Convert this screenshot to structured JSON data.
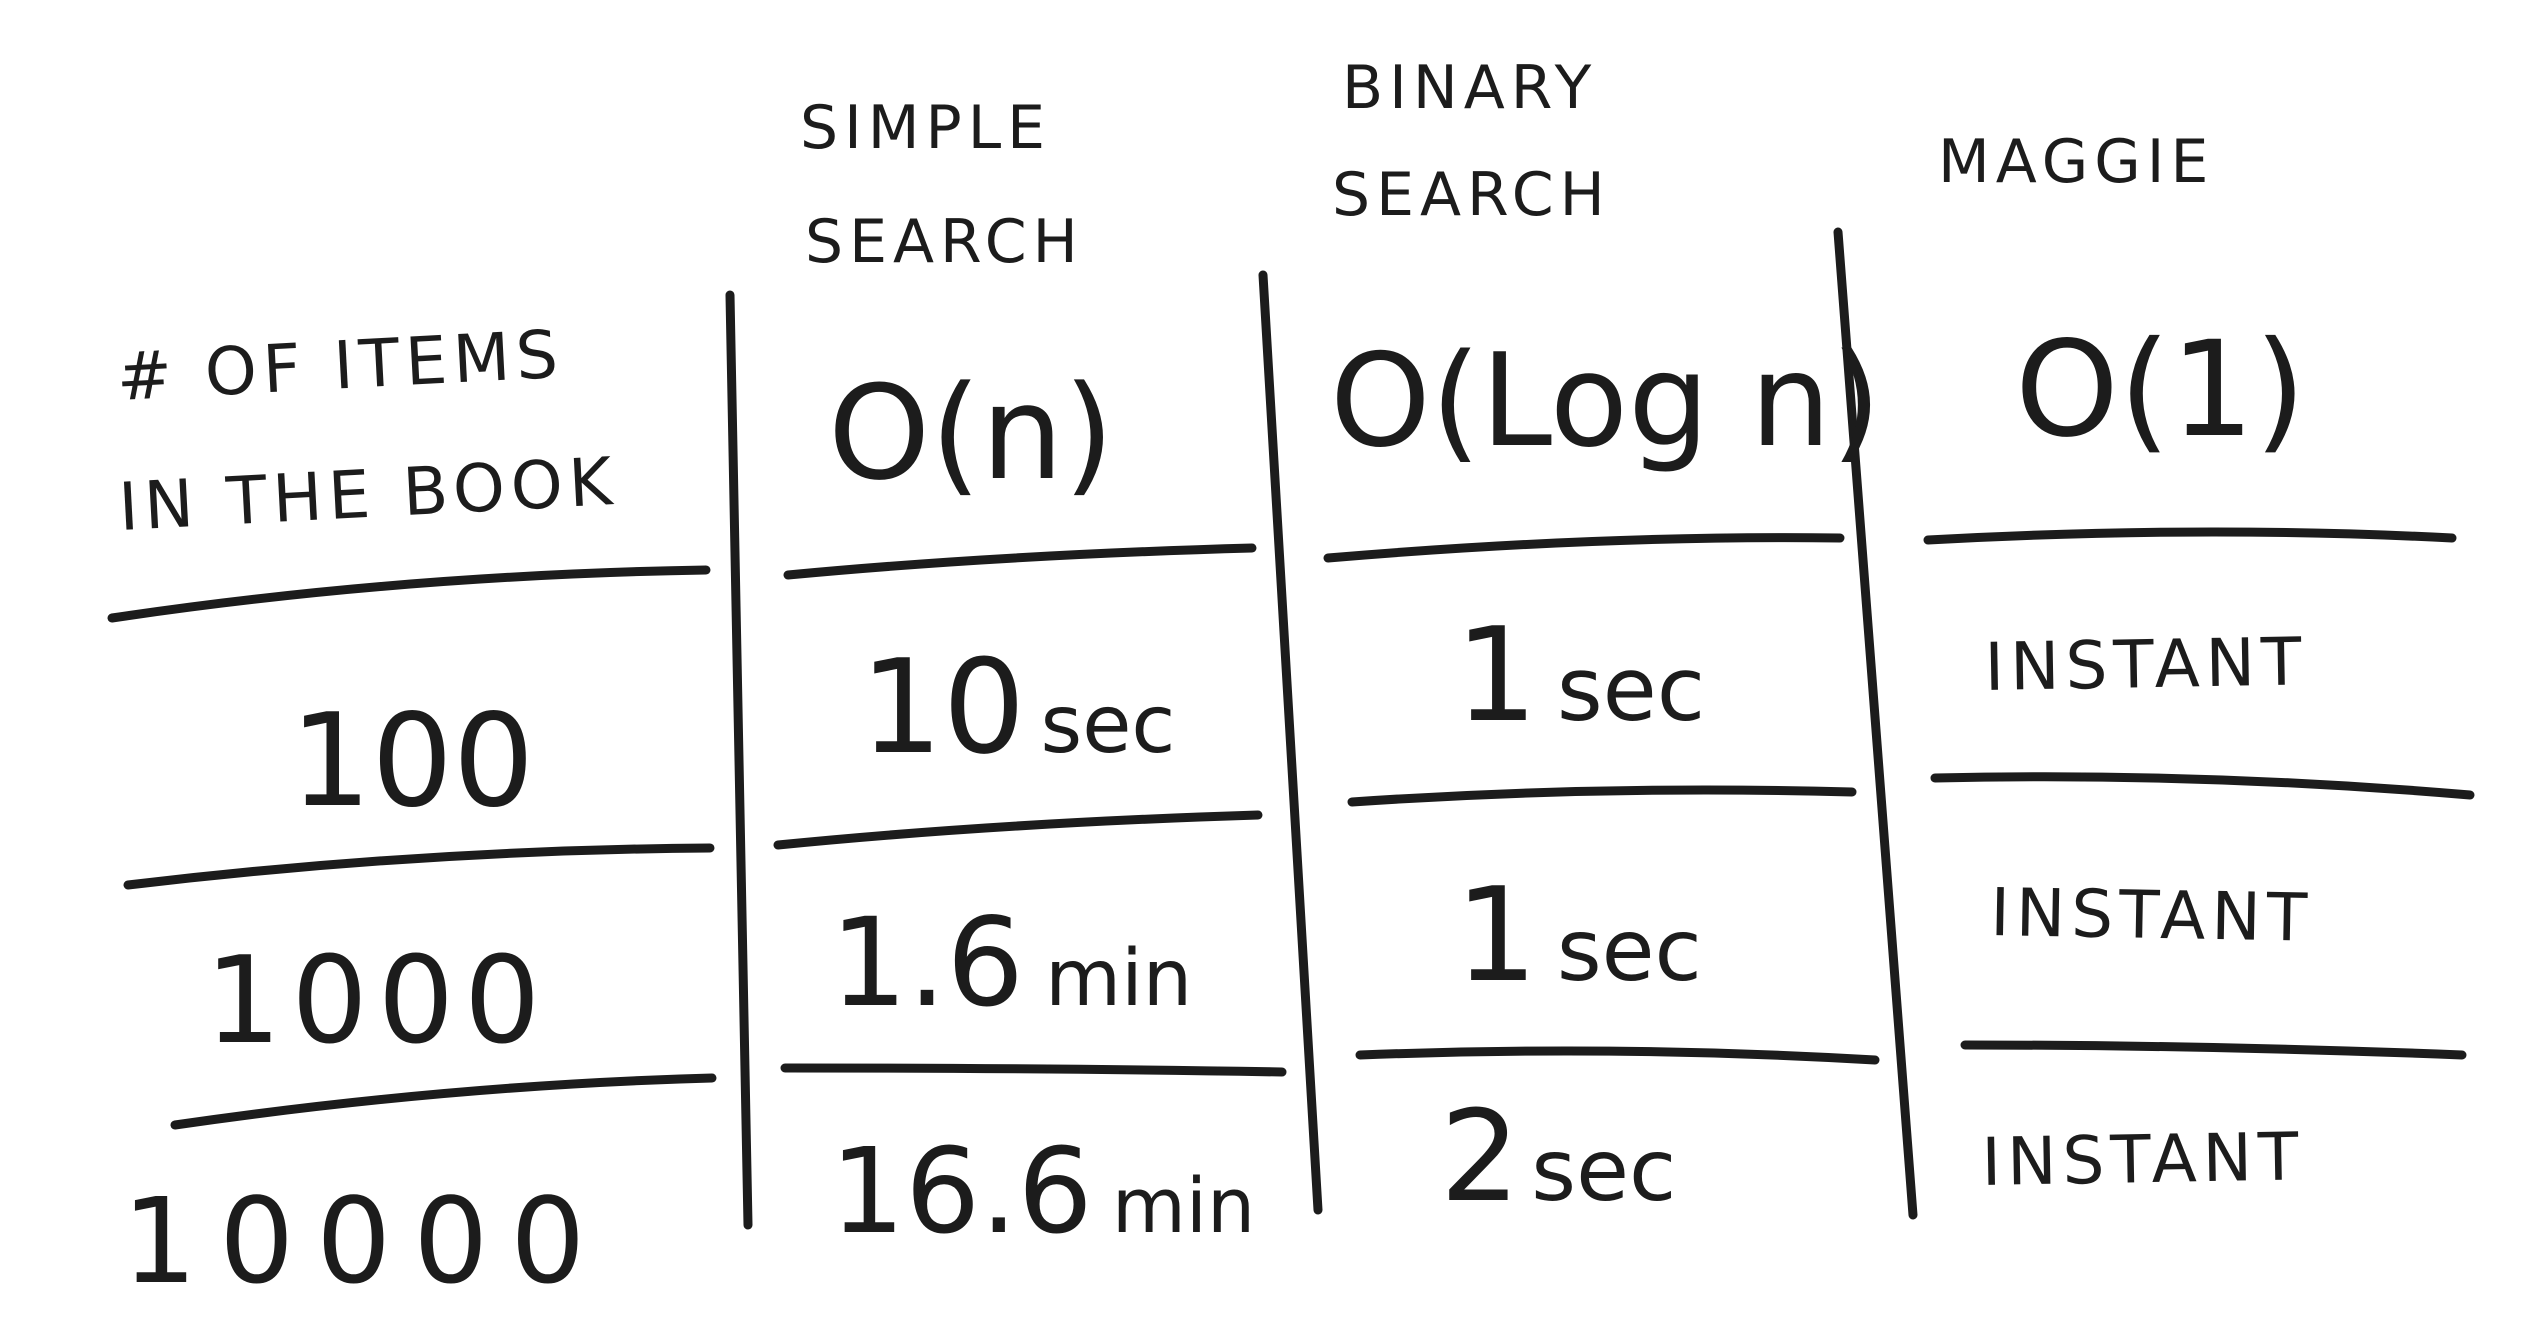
{
  "columns": [
    {
      "header_lines": [
        "# OF ITEMS",
        "IN THE BOOK"
      ],
      "complexity": ""
    },
    {
      "header_lines": [
        "SIMPLE",
        "SEARCH"
      ],
      "complexity": "O(n)"
    },
    {
      "header_lines": [
        "BINARY",
        "SEARCH"
      ],
      "complexity": "O(Log n)"
    },
    {
      "header_lines": [
        "MAGGIE"
      ],
      "complexity": "O(1)"
    }
  ],
  "rows": [
    {
      "items": "100",
      "simple": {
        "num": "10",
        "unit": "sec"
      },
      "binary": {
        "num": "1",
        "unit": "sec"
      },
      "maggie": "INSTANT"
    },
    {
      "items": "1000",
      "simple": {
        "num": "1.6",
        "unit": "min"
      },
      "binary": {
        "num": "1",
        "unit": "sec"
      },
      "maggie": "INSTANT"
    },
    {
      "items": "10000",
      "simple": {
        "num": "16.6",
        "unit": "min"
      },
      "binary": {
        "num": "2",
        "unit": "sec"
      },
      "maggie": "INSTANT"
    }
  ],
  "style": {
    "ink_color": "#1c1c1c",
    "paper_color": "#ffffff"
  }
}
